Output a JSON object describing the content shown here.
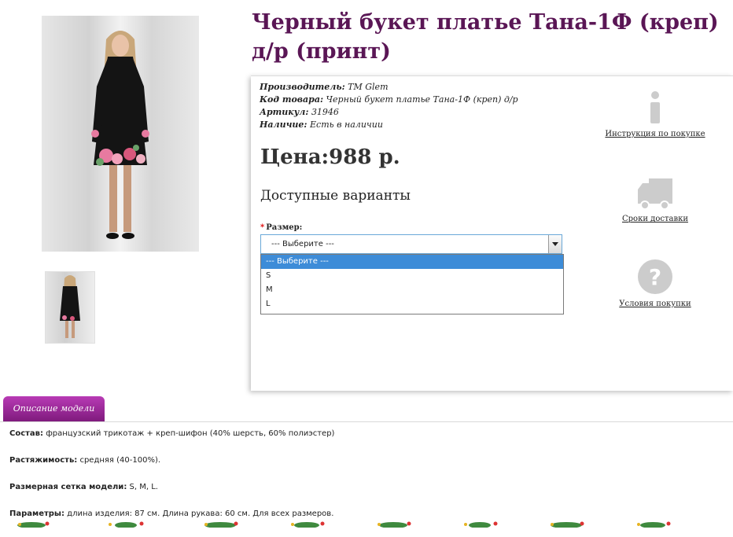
{
  "product": {
    "title": "Черный букет платье Тана-1Ф (креп) д/р (принт)",
    "meta": [
      {
        "label": "Производитель:",
        "value": "TM Glem"
      },
      {
        "label": "Код товара:",
        "value": "Черный букет платье Тана-1Ф (креп) д/р"
      },
      {
        "label": "Артикул:",
        "value": "31946"
      },
      {
        "label": "Наличие:",
        "value": "Есть в наличии"
      }
    ],
    "price": "Цена:988 р.",
    "variants_heading": "Доступные варианты",
    "size": {
      "required_mark": "*",
      "label": "Размер:",
      "selected": "--- Выберите ---",
      "options": [
        "--- Выберите ---",
        "S",
        "M",
        "L"
      ]
    }
  },
  "side_links": [
    {
      "label": "Инструкция по покупке",
      "icon": "info-icon"
    },
    {
      "label": "Сроки доставки",
      "icon": "truck-icon"
    },
    {
      "label": "Условия покупки",
      "icon": "question-icon"
    }
  ],
  "tabs": [
    {
      "label": "Описание модели"
    }
  ],
  "description": [
    {
      "label": "Состав:",
      "text": " французский трикотаж + креп-шифон (40% шерсть, 60% полиэстер)"
    },
    {
      "label": "Растяжимость:",
      "text": " средняя (40-100%)."
    },
    {
      "label": "Размерная сетка модели:",
      "text": " S, M, L."
    },
    {
      "label": "Параметры:",
      "text": " длина изделия: 87 см. Длина рукава: 60 см. Для всех размеров."
    }
  ],
  "colors": {
    "title": "#5a1655",
    "tab": "#9a2a98",
    "selected_option": "#3d8cd8",
    "icon": "#cccccc"
  }
}
